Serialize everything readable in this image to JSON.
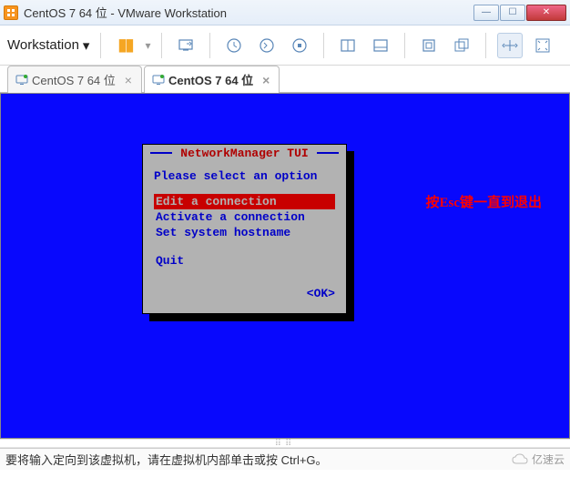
{
  "window": {
    "title": "CentOS 7 64 位 - VMware Workstation"
  },
  "toolbar": {
    "menu_label": "Workstation"
  },
  "tabs": {
    "items": [
      {
        "label": "CentOS 7 64 位",
        "active": false
      },
      {
        "label": "CentOS 7 64 位",
        "active": true
      }
    ]
  },
  "tui": {
    "title": "NetworkManager TUI",
    "prompt": "Please select an option",
    "items": [
      "Edit a connection",
      "Activate a connection",
      "Set system hostname"
    ],
    "quit": "Quit",
    "ok": "<OK>"
  },
  "annotation": "按Esc键一直到退出",
  "statusbar": {
    "hint": "要将输入定向到该虚拟机，请在虚拟机内部单击或按 Ctrl+G。",
    "watermark": "亿速云"
  }
}
